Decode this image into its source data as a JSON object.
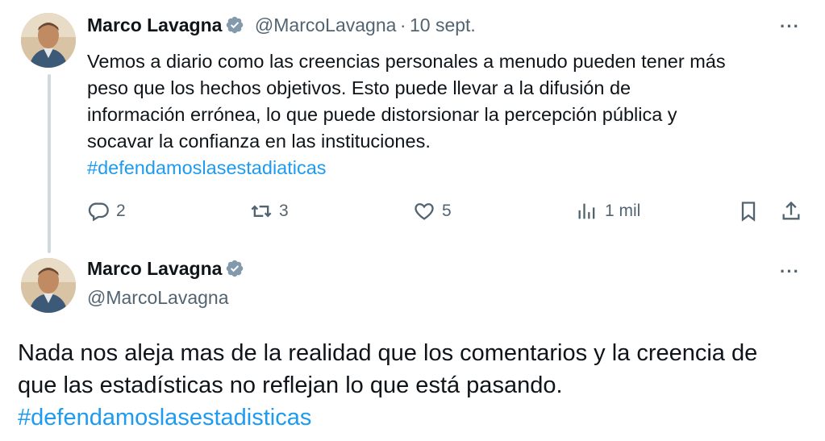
{
  "tweet1": {
    "author_name": "Marco Lavagna",
    "handle": "@MarcoLavagna",
    "separator": "·",
    "date": "10 sept.",
    "text_lines": [
      "Vemos a diario como las creencias personales a menudo pueden tener más",
      "peso que los hechos objetivos. Esto puede llevar a la difusión de",
      "información errónea, lo que puede distorsionar la percepción pública y",
      "socavar la confianza en las instituciones."
    ],
    "hashtag": "#defendamoslasestadiaticas",
    "more_label": "···",
    "actions": {
      "replies": "2",
      "retweets": "3",
      "likes": "5",
      "views": "1 mil"
    },
    "icons": [
      "reply-icon",
      "retweet-icon",
      "like-icon",
      "views-icon",
      "bookmark-icon",
      "share-icon"
    ]
  },
  "tweet2": {
    "author_name": "Marco Lavagna",
    "handle": "@MarcoLavagna",
    "text_lines": [
      "Nada nos aleja mas de la realidad que los comentarios y la creencia de",
      "que las estadísticas no reflejan lo que está pasando."
    ],
    "hashtag": "#defendamoslasestadisticas",
    "more_label": "···"
  },
  "colors": {
    "text": "#0f1419",
    "muted": "#536471",
    "link": "#1d9bf0",
    "thread_line": "#cfd9de",
    "verified_badge": "#829aab"
  }
}
